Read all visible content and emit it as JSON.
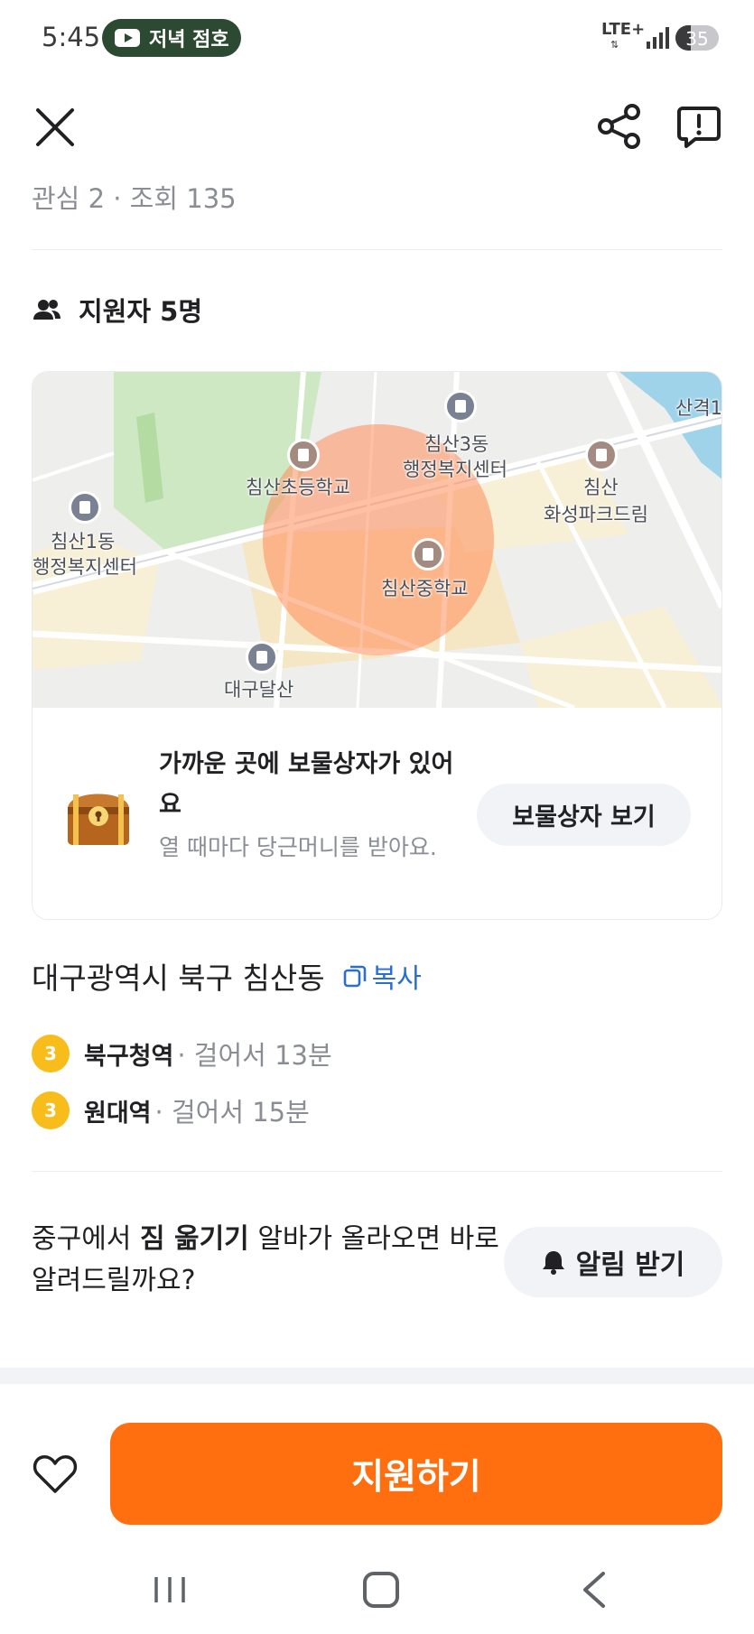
{
  "status_bar": {
    "time": "5:45",
    "media_label": "저녁 점호",
    "network": "LTE+",
    "battery": "35",
    "battery_level": 0.35
  },
  "header": {
    "stats": "관심 2 · 조회 135"
  },
  "applicants": {
    "label": "지원자 5명"
  },
  "map": {
    "labels": [
      "산격1",
      "침산3동",
      "행정복지센터",
      "침산초등학교",
      "침산",
      "화성파크드림",
      "침산1동",
      "행정복지센터",
      "침산중학교",
      "대구달산"
    ],
    "colors": {
      "radius": "#ff8c5a",
      "park": "#cfe8c4",
      "river": "#9fd3ea",
      "poi": "#7a8192",
      "poi_warm": "#a38b82"
    }
  },
  "treasure": {
    "title": "가까운 곳에 보물상자가 있어요",
    "description": "열 때마다 당근머니를 받아요.",
    "button_label": "보물상자 보기"
  },
  "location": {
    "address": "대구광역시 북구 침산동",
    "copy_label": "복사",
    "stations": [
      {
        "line": "3",
        "name": "북구청역",
        "walk": "· 걸어서 13분"
      },
      {
        "line": "3",
        "name": "원대역",
        "walk": "· 걸어서 15분"
      }
    ]
  },
  "alert": {
    "prefix": "중구에서 ",
    "keyword": "짐 옮기기",
    "suffix": " 알바가 올라오면 바로 알려드릴까요?",
    "button_label": "알림 받기"
  },
  "bottom": {
    "apply_label": "지원하기"
  },
  "colors": {
    "accent": "#ff6f0f",
    "link": "#2a6fd0",
    "subway_line_3": "#f8bd1b"
  }
}
